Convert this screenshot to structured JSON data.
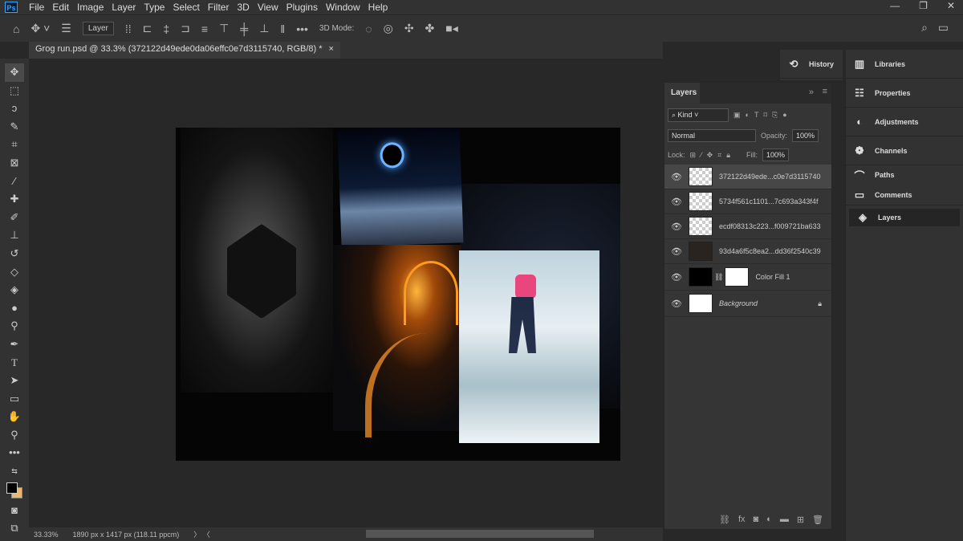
{
  "app": {
    "logo": "Ps"
  },
  "menu": [
    "File",
    "Edit",
    "Image",
    "Layer",
    "Type",
    "Select",
    "Filter",
    "3D",
    "View",
    "Plugins",
    "Window",
    "Help"
  ],
  "options": {
    "auto_select": "Layer",
    "three_d_mode": "3D Mode:"
  },
  "document": {
    "tab_title": "Grog run.psd @ 33.3% (372122d49ede0da06effc0e7d3115740, RGB/8) *",
    "close": "×"
  },
  "status": {
    "zoom": "33.33%",
    "dimensions": "1890 px x 1417 px (118.11 ppcm)"
  },
  "layers_panel": {
    "title": "Layers",
    "filter_kind": "Kind",
    "blend_mode": "Normal",
    "opacity_label": "Opacity:",
    "opacity": "100%",
    "lock_label": "Lock:",
    "fill_label": "Fill:",
    "fill": "100%",
    "layers": [
      {
        "name": "372122d49ede...c0e7d3115740",
        "active": true
      },
      {
        "name": "5734f561c1101...7c693a343f4f"
      },
      {
        "name": "ecdf08313c223...f009721ba633"
      },
      {
        "name": "93d4a6f5c8ea2...dd36f2540c39"
      },
      {
        "name": "Color Fill 1"
      },
      {
        "name": "Background",
        "locked": true
      }
    ]
  },
  "side_panels": {
    "history": "History",
    "right": [
      "Libraries",
      "Properties",
      "Adjustments",
      "Channels",
      "Paths",
      "Comments",
      "Layers"
    ]
  },
  "colors": {
    "accent": "#31a8ff",
    "background_swatch": "#e8b774"
  }
}
